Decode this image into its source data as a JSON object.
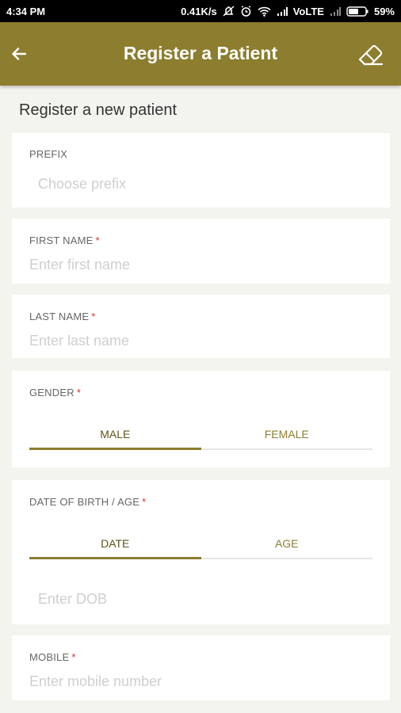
{
  "status_bar": {
    "time": "4:34 PM",
    "speed": "0.41K/s",
    "network": "VoLTE",
    "battery": "59%"
  },
  "app_bar": {
    "title": "Register a Patient",
    "back_icon": "arrow-left-icon",
    "clear_icon": "eraser-icon"
  },
  "section_title": "Register a new patient",
  "form": {
    "prefix": {
      "label": "PREFIX",
      "placeholder": "Choose prefix"
    },
    "first_name": {
      "label": "FIRST NAME",
      "required": "*",
      "placeholder": "Enter first name"
    },
    "last_name": {
      "label": "LAST NAME",
      "required": "*",
      "placeholder": "Enter last name"
    },
    "gender": {
      "label": "GENDER",
      "required": "*",
      "options": [
        "MALE",
        "FEMALE"
      ],
      "selected": "MALE"
    },
    "dob": {
      "label": "DATE OF BIRTH / AGE",
      "required": "*",
      "options": [
        "DATE",
        "AGE"
      ],
      "selected": "DATE",
      "placeholder": "Enter DOB"
    },
    "mobile": {
      "label": "MOBILE",
      "required": "*",
      "placeholder": "Enter mobile number"
    }
  },
  "colors": {
    "accent": "#8c7d2f",
    "required": "#d32f2f"
  }
}
